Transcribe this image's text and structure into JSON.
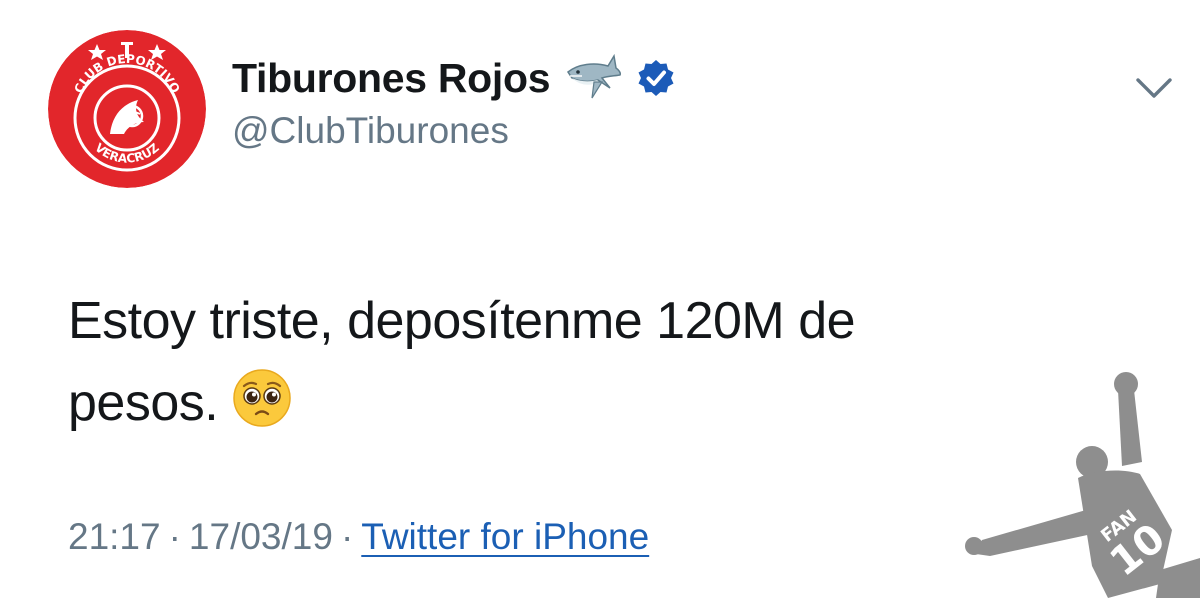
{
  "account": {
    "display_name": "Tiburones Rojos",
    "handle": "@ClubTiburones",
    "name_emoji": "shark-emoji",
    "verified": true,
    "verified_color": "#1c5bb8",
    "avatar": {
      "ring_text_top": "CLUB DEPORTIVO",
      "ring_text_bottom": "VERACRUZ",
      "background_color": "#e2262b"
    }
  },
  "tweet": {
    "text_line1": "Estoy triste, deposítenme 120M de",
    "text_line2": "pesos.",
    "emoji": "pleading-face-emoji"
  },
  "meta": {
    "time": "21:17",
    "date": "17/03/19",
    "separator": "·",
    "source": "Twitter for iPhone",
    "link_color": "#1b5fb4"
  },
  "watermark": {
    "text_top": "FAN",
    "text_bottom": "10"
  },
  "icons": {
    "menu": "chevron-down-icon"
  }
}
